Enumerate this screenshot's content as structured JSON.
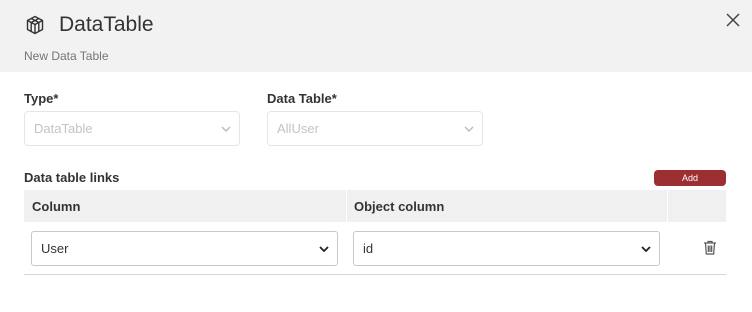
{
  "dialog": {
    "title": "DataTable",
    "subtitle": "New Data Table"
  },
  "form": {
    "type_label": "Type*",
    "type_value": "DataTable",
    "datatable_label": "Data Table*",
    "datatable_value": "AllUser"
  },
  "links": {
    "section_label": "Data table links",
    "add_label": "Add",
    "columns": [
      "Column",
      "Object column"
    ],
    "rows": [
      {
        "column": "User",
        "object_column": "id"
      }
    ]
  },
  "icons": {
    "header": "cube-icon",
    "close": "close-icon",
    "delete": "trash-icon",
    "dropdown": "chevron-down-icon"
  },
  "colors": {
    "accent": "#9b2f32",
    "header_bg": "#f2f2f2",
    "table_header_bg": "#f0f0f0"
  }
}
